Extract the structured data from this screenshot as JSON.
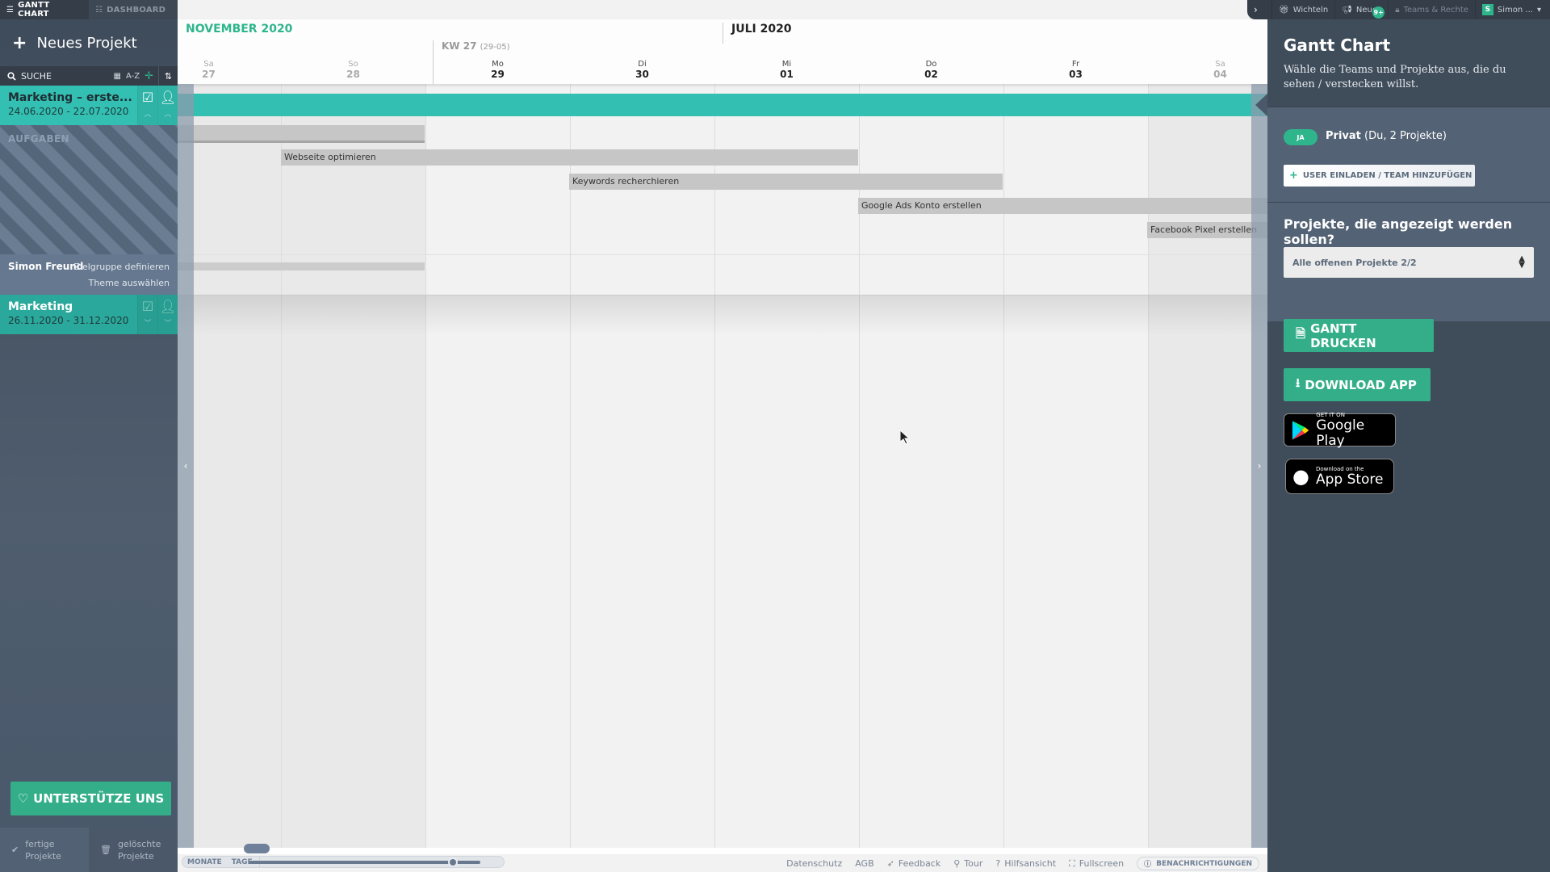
{
  "topnav_left": {
    "tabs": [
      {
        "label": "GANTT CHART",
        "icon": "gantt-icon",
        "active": true
      },
      {
        "label": "DASHBOARD",
        "icon": "list-icon",
        "active": false
      }
    ],
    "collapse_icon": "chevron-left-icon"
  },
  "sidebar": {
    "new_project_label": "Neues Projekt",
    "search_label": "SUCHE",
    "sort_az_label": "A-Z",
    "projects": [
      {
        "title": "Marketing – erste...",
        "dates": "24.06.2020 - 22.07.2020",
        "color": "#33bfb2"
      },
      {
        "title": "Marketing",
        "dates": "26.11.2020 - 31.12.2020",
        "color": "#2aa89b"
      }
    ],
    "tasks_header": "AUFGABEN",
    "member": {
      "name": "Simon Freund",
      "tasks": [
        "Zielgruppe definieren",
        "Theme auswählen"
      ]
    },
    "support_button": "UNTERSTÜTZE UNS",
    "bottom": [
      {
        "line1": "fertige",
        "line2": "Projekte",
        "icon": "check-icon"
      },
      {
        "line1": "gelöschte",
        "line2": "Projekte",
        "icon": "trash-icon"
      }
    ]
  },
  "gantt": {
    "months": [
      "NOVEMBER 2020",
      "JULI 2020"
    ],
    "week": {
      "label": "KW 27",
      "range": "(29-05)"
    },
    "days": [
      {
        "name": "Sa",
        "num": "27",
        "weekend": true
      },
      {
        "name": "So",
        "num": "28",
        "weekend": true
      },
      {
        "name": "Mo",
        "num": "29",
        "weekend": false
      },
      {
        "name": "Di",
        "num": "30",
        "weekend": false
      },
      {
        "name": "Mi",
        "num": "01",
        "weekend": false
      },
      {
        "name": "Do",
        "num": "02",
        "weekend": false
      },
      {
        "name": "Fr",
        "num": "03",
        "weekend": false
      },
      {
        "name": "Sa",
        "num": "04",
        "weekend": true
      }
    ],
    "tasks": [
      {
        "label": ""
      },
      {
        "label": "Webseite optimieren"
      },
      {
        "label": "Keywords recherchieren"
      },
      {
        "label": "Google Ads Konto erstellen"
      },
      {
        "label": "Facebook Pixel erstellen"
      }
    ],
    "zoom": {
      "left_label": "MONATE",
      "right_label": "TAGE",
      "level": 0.88
    },
    "footer_links": [
      "Datenschutz",
      "AGB",
      "Feedback",
      "Tour",
      "Hilfsansicht",
      "Fullscreen"
    ],
    "notifications_label": "BENACHRICHTIGUNGEN"
  },
  "topnav_right": {
    "items": [
      {
        "label": "Wichteln",
        "icon": "gift-icon"
      },
      {
        "label": "Neues",
        "icon": "megaphone-icon",
        "badge": "9+"
      },
      {
        "label": "Teams & Rechte",
        "icon": "lock-icon"
      },
      {
        "label": "Simon ...",
        "avatar": "S"
      }
    ]
  },
  "right_panel": {
    "title": "Gantt Chart",
    "description": "Wähle die Teams und Projekte aus, die du sehen / verstecken willst.",
    "team": {
      "toggle": "JA",
      "name": "Privat",
      "detail": "(Du, 2 Projekte)"
    },
    "invite_button": "USER EINLADEN / TEAM HINZUFÜGEN",
    "projects_question": "Projekte, die angezeigt werden sollen?",
    "projects_select": "Alle offenen Projekte 2/2",
    "print_button": "GANTT DRUCKEN",
    "download_button": "DOWNLOAD APP",
    "google_play": {
      "small": "GET IT ON",
      "big": "Google Play"
    },
    "app_store": {
      "small": "Download on the",
      "big": "App Store"
    }
  },
  "colors": {
    "accent_green": "#33ae88",
    "project_teal": "#33bfb2",
    "sidebar_dark": "#343d48"
  }
}
